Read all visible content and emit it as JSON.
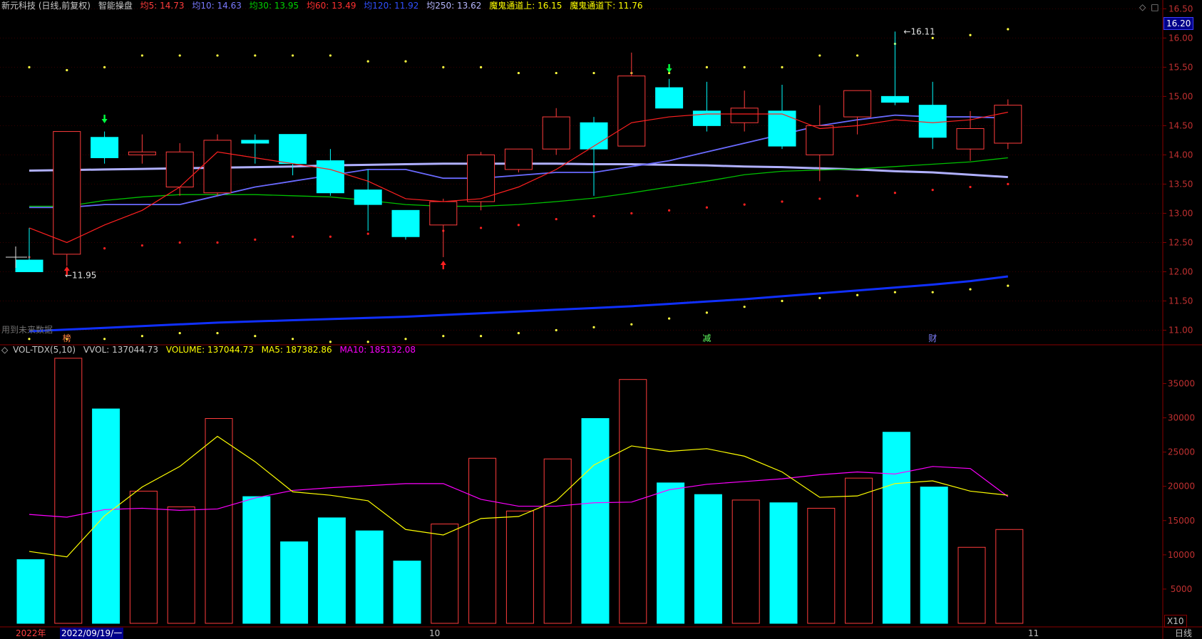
{
  "header": {
    "title": "新元科技 (日线,前复权)",
    "indicator": "智能操盘",
    "ma5": "均5: 14.73",
    "ma10": "均10: 14.63",
    "ma30": "均30: 13.95",
    "ma60": "均60: 13.49",
    "ma120": "均120: 11.92",
    "ma250": "均250: 13.62",
    "channel_up": "魔鬼通道上: 16.15",
    "channel_down": "魔鬼通道下: 11.76"
  },
  "vol_header": {
    "name": "VOL-TDX(5,10)",
    "vvol": "VVOL: 137044.73",
    "volume": "VOLUME: 137044.73",
    "ma5": "MA5: 187382.86",
    "ma10": "MA10: 185132.08"
  },
  "labels": {
    "future_data": "用到未来数据",
    "price_high": "16.11",
    "price_low": "11.95",
    "current_price": "16.20",
    "vol_unit": "X10",
    "period": "日线"
  },
  "markers": {
    "m1": "榜",
    "m2": "减",
    "m3": "财"
  },
  "timeline": {
    "year": "2022年",
    "date": "2022/09/19/一",
    "m10": "10",
    "m11": "11"
  },
  "colors": {
    "up": "#ff3c3c",
    "down": "#00ffff",
    "ma5": "#ff2020",
    "ma10": "#6a6aff",
    "ma30": "#00c000",
    "ma120": "#1030ff",
    "ma250": "#b0b0ff",
    "volma5": "#ffff00",
    "volma10": "#ff00ff"
  },
  "chart_data": {
    "type": "candlestick",
    "price_ylim": [
      10.75,
      16.65
    ],
    "price_ticks": [
      11.0,
      11.5,
      12.0,
      12.5,
      13.0,
      13.5,
      14.0,
      14.5,
      15.0,
      15.5,
      16.0,
      16.5
    ],
    "volume_ticks": [
      5000,
      10000,
      15000,
      20000,
      25000,
      30000,
      35000
    ],
    "volume_ylim": [
      0,
      39000
    ],
    "candles": [
      {
        "o": 12.2,
        "h": 12.75,
        "l": 12.05,
        "c": 12.0,
        "v": 9300
      },
      {
        "o": 12.3,
        "h": 14.4,
        "l": 12.1,
        "c": 14.4,
        "v": 38700
      },
      {
        "o": 14.3,
        "h": 14.4,
        "l": 13.85,
        "c": 13.95,
        "v": 31300
      },
      {
        "o": 14.0,
        "h": 14.35,
        "l": 13.85,
        "c": 14.05,
        "v": 19300
      },
      {
        "o": 13.45,
        "h": 14.2,
        "l": 13.3,
        "c": 14.05,
        "v": 17000
      },
      {
        "o": 13.35,
        "h": 14.35,
        "l": 13.3,
        "c": 14.25,
        "v": 29900
      },
      {
        "o": 14.25,
        "h": 14.35,
        "l": 13.85,
        "c": 14.2,
        "v": 18500
      },
      {
        "o": 14.35,
        "h": 14.35,
        "l": 13.65,
        "c": 13.85,
        "v": 11900
      },
      {
        "o": 13.9,
        "h": 14.1,
        "l": 13.3,
        "c": 13.35,
        "v": 15400
      },
      {
        "o": 13.4,
        "h": 13.75,
        "l": 12.7,
        "c": 13.15,
        "v": 13500
      },
      {
        "o": 13.05,
        "h": 13.05,
        "l": 12.55,
        "c": 12.6,
        "v": 9100
      },
      {
        "o": 12.8,
        "h": 13.25,
        "l": 12.25,
        "c": 13.2,
        "v": 14500
      },
      {
        "o": 13.2,
        "h": 14.05,
        "l": 13.05,
        "c": 14.0,
        "v": 24100
      },
      {
        "o": 13.75,
        "h": 14.1,
        "l": 13.7,
        "c": 14.1,
        "v": 16400
      },
      {
        "o": 14.1,
        "h": 14.8,
        "l": 14.0,
        "c": 14.65,
        "v": 24000
      },
      {
        "o": 14.55,
        "h": 14.65,
        "l": 13.3,
        "c": 14.1,
        "v": 29900
      },
      {
        "o": 14.15,
        "h": 15.75,
        "l": 14.15,
        "c": 15.35,
        "v": 35600
      },
      {
        "o": 15.15,
        "h": 15.3,
        "l": 14.8,
        "c": 14.8,
        "v": 20500
      },
      {
        "o": 14.75,
        "h": 15.25,
        "l": 14.4,
        "c": 14.5,
        "v": 18800
      },
      {
        "o": 14.55,
        "h": 15.1,
        "l": 14.4,
        "c": 14.8,
        "v": 18000
      },
      {
        "o": 14.75,
        "h": 15.2,
        "l": 14.1,
        "c": 14.15,
        "v": 17600
      },
      {
        "o": 14.0,
        "h": 14.85,
        "l": 13.55,
        "c": 14.5,
        "v": 16800
      },
      {
        "o": 14.65,
        "h": 15.1,
        "l": 14.35,
        "c": 15.1,
        "v": 21200
      },
      {
        "o": 15.0,
        "h": 16.11,
        "l": 14.85,
        "c": 14.9,
        "v": 27900
      },
      {
        "o": 14.85,
        "h": 15.25,
        "l": 14.1,
        "c": 14.3,
        "v": 19900
      },
      {
        "o": 14.1,
        "h": 14.75,
        "l": 13.9,
        "c": 14.45,
        "v": 11100
      },
      {
        "o": 14.2,
        "h": 14.95,
        "l": 14.1,
        "c": 14.85,
        "v": 13700
      }
    ],
    "ma5_line": [
      12.75,
      12.5,
      12.8,
      13.05,
      13.45,
      14.05,
      13.95,
      13.85,
      13.75,
      13.55,
      13.25,
      13.2,
      13.25,
      13.45,
      13.75,
      14.15,
      14.55,
      14.65,
      14.7,
      14.7,
      14.7,
      14.45,
      14.5,
      14.6,
      14.55,
      14.6,
      14.73
    ],
    "ma10_line": [
      13.1,
      13.1,
      13.15,
      13.15,
      13.15,
      13.3,
      13.45,
      13.55,
      13.65,
      13.75,
      13.75,
      13.6,
      13.6,
      13.65,
      13.7,
      13.7,
      13.8,
      13.9,
      14.05,
      14.2,
      14.35,
      14.5,
      14.6,
      14.68,
      14.65,
      14.65,
      14.63
    ],
    "ma30_line": [
      13.12,
      13.12,
      13.22,
      13.28,
      13.32,
      13.32,
      13.32,
      13.3,
      13.28,
      13.22,
      13.15,
      13.12,
      13.12,
      13.15,
      13.2,
      13.26,
      13.35,
      13.45,
      13.55,
      13.66,
      13.72,
      13.74,
      13.76,
      13.8,
      13.84,
      13.88,
      13.95
    ],
    "ma120_line": [
      10.98,
      11.01,
      11.04,
      11.07,
      11.1,
      11.13,
      11.15,
      11.17,
      11.19,
      11.21,
      11.23,
      11.26,
      11.29,
      11.32,
      11.35,
      11.38,
      11.41,
      11.45,
      11.49,
      11.53,
      11.58,
      11.63,
      11.68,
      11.73,
      11.78,
      11.84,
      11.92
    ],
    "ma250_line": [
      13.73,
      13.74,
      13.75,
      13.76,
      13.77,
      13.78,
      13.79,
      13.8,
      13.82,
      13.83,
      13.84,
      13.85,
      13.85,
      13.85,
      13.85,
      13.84,
      13.84,
      13.83,
      13.82,
      13.8,
      13.79,
      13.77,
      13.75,
      13.72,
      13.7,
      13.66,
      13.62
    ],
    "channel_up_dots": [
      15.5,
      15.45,
      15.5,
      15.7,
      15.7,
      15.7,
      15.7,
      15.7,
      15.7,
      15.6,
      15.6,
      15.5,
      15.5,
      15.4,
      15.4,
      15.4,
      15.4,
      15.4,
      15.5,
      15.5,
      15.5,
      15.7,
      15.7,
      15.9,
      16.0,
      16.05,
      16.15
    ],
    "channel_down_dots": [
      10.85,
      10.85,
      10.85,
      10.9,
      10.95,
      10.95,
      10.9,
      10.85,
      10.8,
      10.8,
      10.85,
      10.9,
      10.9,
      10.95,
      11.0,
      11.05,
      11.1,
      11.2,
      11.3,
      11.4,
      11.5,
      11.55,
      11.6,
      11.65,
      11.65,
      11.7,
      11.76
    ],
    "mid_red_dots": [
      12.25,
      12.35,
      12.4,
      12.45,
      12.5,
      12.5,
      12.55,
      12.6,
      12.6,
      12.65,
      12.65,
      12.7,
      12.75,
      12.8,
      12.9,
      12.95,
      13.0,
      13.05,
      13.1,
      13.15,
      13.2,
      13.25,
      13.3,
      13.35,
      13.4,
      13.45,
      13.5
    ],
    "vol_ma5": [
      10500,
      9700,
      15700,
      19900,
      22900,
      27300,
      23600,
      19200,
      18700,
      17900,
      13700,
      12900,
      15300,
      15600,
      17900,
      23100,
      25900,
      25100,
      25500,
      24400,
      22100,
      18400,
      18600,
      20400,
      20800,
      19300,
      18700
    ],
    "vol_ma10": [
      15900,
      15500,
      16600,
      16800,
      16500,
      16700,
      18300,
      19400,
      19800,
      20100,
      20400,
      20400,
      18100,
      17100,
      17100,
      17600,
      17700,
      19500,
      20300,
      20700,
      21100,
      21700,
      22100,
      21800,
      22900,
      22600,
      18500
    ]
  }
}
